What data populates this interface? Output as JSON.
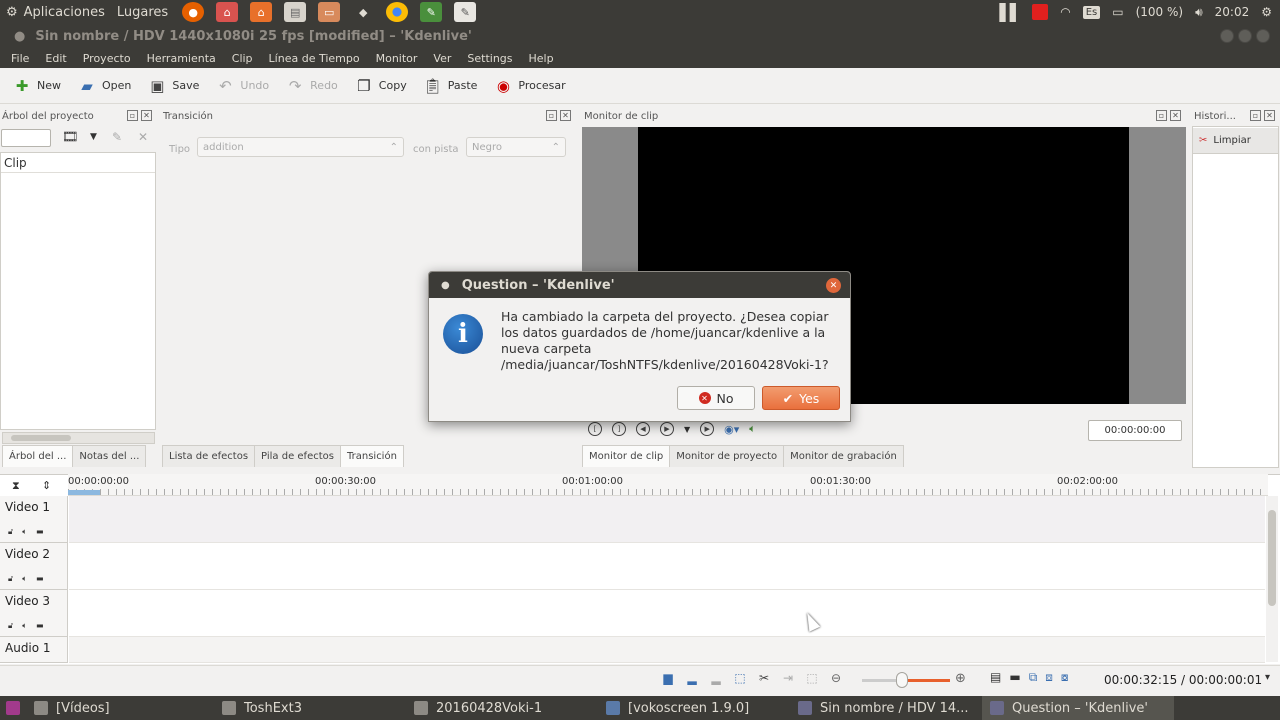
{
  "system_panel": {
    "apps_label": "Aplicaciones",
    "places_label": "Lugares",
    "keyboard": "Es",
    "battery": "(100 %)",
    "clock": "20:02"
  },
  "window": {
    "title": "Sin nombre / HDV 1440x1080i 25 fps [modified] – 'Kdenlive'"
  },
  "menu": [
    "File",
    "Edit",
    "Proyecto",
    "Herramienta",
    "Clip",
    "Línea de Tiempo",
    "Monitor",
    "Ver",
    "Settings",
    "Help"
  ],
  "toolbar": {
    "new": "New",
    "open": "Open",
    "save": "Save",
    "undo": "Undo",
    "redo": "Redo",
    "copy": "Copy",
    "paste": "Paste",
    "render": "Procesar"
  },
  "docks": {
    "project_tree_title": "Árbol del proyecto",
    "transition_title": "Transición",
    "clip_monitor_title": "Monitor de clip",
    "history_title": "Histori...",
    "clip_column": "Clip",
    "tipo_label": "Tipo",
    "tipo_value": "addition",
    "con_pista_label": "con pista",
    "con_pista_value": "Negro",
    "limpiar": "Limpiar",
    "monitor_timecode": "00:00:00:00"
  },
  "tabs_left": [
    "Árbol del ...",
    "Notas del ..."
  ],
  "tabs_mid": [
    "Lista de efectos",
    "Pila de efectos",
    "Transición"
  ],
  "tabs_monitor": [
    "Monitor de clip",
    "Monitor de proyecto",
    "Monitor de grabación"
  ],
  "timeline": {
    "ruler": [
      "00:00:00:00",
      "00:00:30:00",
      "00:01:00:00",
      "00:01:30:00",
      "00:02:00:00"
    ],
    "tracks": [
      "Video 1",
      "Video 2",
      "Video 3",
      "Audio 1"
    ]
  },
  "statusbar": {
    "time": "00:00:32:15 / 00:00:00:01"
  },
  "taskbar": [
    "[Vídeos]",
    "ToshExt3",
    "20160428Voki-1",
    "[vokoscreen 1.9.0]",
    "Sin nombre / HDV 14...",
    "Question – 'Kdenlive'"
  ],
  "dialog": {
    "title": "Question – 'Kdenlive'",
    "message": "Ha cambiado la carpeta del proyecto. ¿Desea copiar los datos guardados de /home/juancar/kdenlive a la nueva carpeta /media/juancar/ToshNTFS/kdenlive/20160428Voki-1?",
    "no_label": "No",
    "yes_label": "Yes"
  }
}
